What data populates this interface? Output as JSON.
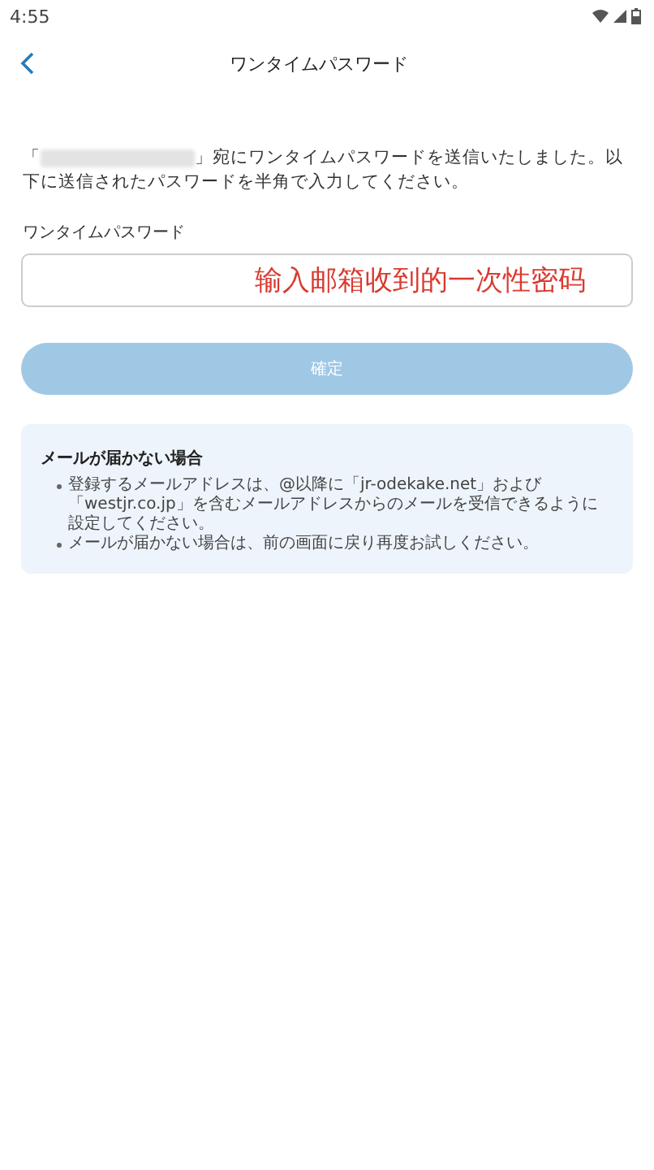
{
  "status_bar": {
    "time": "4:55"
  },
  "header": {
    "title": "ワンタイムパスワード"
  },
  "message": {
    "before": "「",
    "after": "」宛にワンタイムパスワードを送信いたしました。以下に送信されたパスワードを半角で入力してください。"
  },
  "field": {
    "label": "ワンタイムパスワード",
    "overlay_text": "输入邮箱收到的一次性密码"
  },
  "confirm_button": {
    "label": "確定",
    "disabled": true
  },
  "notes": {
    "title": "メールが届かない場合",
    "items": [
      "登録するメールアドレスは、@以降に「jr-odekake.net」および「westjr.co.jp」を含むメールアドレスからのメールを受信できるように設定してください。",
      "メールが届かない場合は、前の画面に戻り再度お試しください。"
    ]
  }
}
